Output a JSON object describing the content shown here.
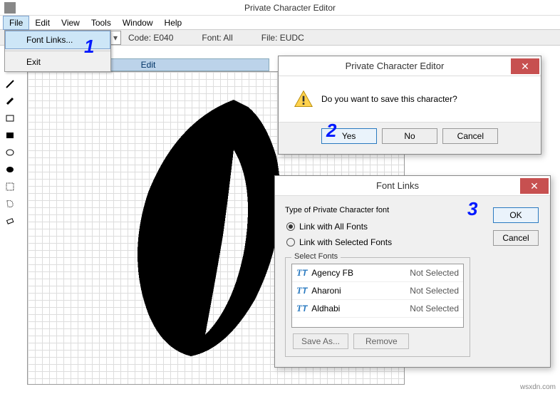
{
  "window": {
    "title": "Private Character Editor"
  },
  "menu": {
    "file": "File",
    "edit": "Edit",
    "view": "View",
    "tools": "Tools",
    "window": "Window",
    "help": "Help"
  },
  "file_menu": {
    "font_links": "Font Links...",
    "exit": "Exit"
  },
  "infobar": {
    "code": "Code: E040",
    "font": "Font: All",
    "file": "File: EUDC"
  },
  "edit_tab": "Edit",
  "annotations": {
    "one": "1",
    "two": "2",
    "three": "3"
  },
  "save_dialog": {
    "title": "Private Character Editor",
    "message": "Do you want to save this character?",
    "yes": "Yes",
    "no": "No",
    "cancel": "Cancel"
  },
  "fontlinks_dialog": {
    "title": "Font Links",
    "group_label": "Type of Private Character font",
    "opt_all": "Link with All Fonts",
    "opt_selected": "Link with Selected Fonts",
    "select_fonts_label": "Select Fonts",
    "fonts": [
      {
        "name": "Agency FB",
        "status": "Not Selected"
      },
      {
        "name": "Aharoni",
        "status": "Not Selected"
      },
      {
        "name": "Aldhabi",
        "status": "Not Selected"
      }
    ],
    "save_as": "Save As...",
    "remove": "Remove",
    "ok": "OK",
    "cancel": "Cancel"
  },
  "watermark": "wsxdn.com"
}
